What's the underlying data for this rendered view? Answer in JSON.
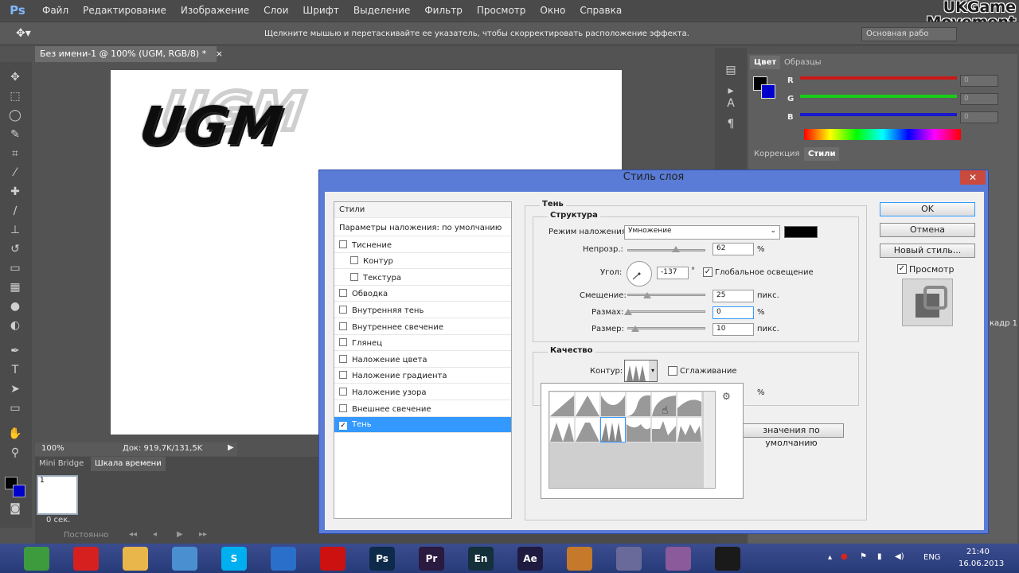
{
  "app": {
    "logo": "Ps",
    "menu": [
      "Файл",
      "Редактирование",
      "Изображение",
      "Слои",
      "Шрифт",
      "Выделение",
      "Фильтр",
      "Просмотр",
      "Окно",
      "Справка"
    ],
    "watermark_line1": "UKGame",
    "watermark_line2": "Movement"
  },
  "options_bar": {
    "hint": "Щелкните мышью и перетаскивайте ее указатель, чтобы скорректировать расположение эффекта.",
    "workspace": "Основная рабо"
  },
  "document": {
    "tab_title": "Без имени-1 @ 100% (UGM, RGB/8) *",
    "canvas_text": "UGM",
    "zoom": "100%",
    "doc_info": "Док: 919,7K/131,5K"
  },
  "timeline": {
    "tab_mini_bridge": "Mini Bridge",
    "tab_timeline": "Шкала времени",
    "frame_number": "1",
    "frame_time": "0 сек.",
    "loop": "Постоянно"
  },
  "color_panel": {
    "tab_color": "Цвет",
    "tab_swatches": "Образцы",
    "r_label": "R",
    "g_label": "G",
    "b_label": "B",
    "r_value": "0",
    "g_value": "0",
    "b_value": "0"
  },
  "styles_panel": {
    "tab_adjustments": "Коррекция",
    "tab_styles": "Стили",
    "frame_label": "кадр 1"
  },
  "dialog": {
    "title": "Стиль слоя",
    "close": "✕",
    "styles_header": "Стили",
    "blend_defaults": "Параметры наложения: по умолчанию",
    "items": [
      {
        "label": "Тиснение",
        "checked": false
      },
      {
        "label": "Контур",
        "checked": false
      },
      {
        "label": "Текстура",
        "checked": false
      },
      {
        "label": "Обводка",
        "checked": false
      },
      {
        "label": "Внутренняя тень",
        "checked": false
      },
      {
        "label": "Внутреннее свечение",
        "checked": false
      },
      {
        "label": "Глянец",
        "checked": false
      },
      {
        "label": "Наложение цвета",
        "checked": false
      },
      {
        "label": "Наложение градиента",
        "checked": false
      },
      {
        "label": "Наложение узора",
        "checked": false
      },
      {
        "label": "Внешнее свечение",
        "checked": false
      },
      {
        "label": "Тень",
        "checked": true
      }
    ],
    "shadow_title": "Тень",
    "structure_title": "Структура",
    "blend_mode_label": "Режим наложения:",
    "blend_mode_value": "Умножение",
    "opacity_label": "Непрозр.:",
    "opacity_value": "62",
    "opacity_level": 0.62,
    "percent": "%",
    "angle_label": "Угол:",
    "angle_value": "-137",
    "degree": "°",
    "global_light_label": "Глобальное освещение",
    "offset_label": "Смещение:",
    "offset_value": "25",
    "spread_label": "Размах:",
    "spread_value": "0",
    "size_label": "Размер:",
    "size_value": "10",
    "px": "пикс.",
    "quality_title": "Качество",
    "contour_label": "Контур:",
    "antialias_label": "Сглаживание",
    "noise_percent": "%",
    "reset_defaults": "значения по умолчанию",
    "ok": "OK",
    "cancel": "Отмена",
    "new_style": "Новый стиль...",
    "preview_label": "Просмотр",
    "check_mark": "✓",
    "gear": "⚙"
  },
  "taskbar": {
    "apps": [
      {
        "name": "chrome",
        "label": "",
        "color": "#3d9b3d"
      },
      {
        "name": "opera",
        "label": "",
        "color": "#d62020"
      },
      {
        "name": "explorer",
        "label": "",
        "color": "#e8b64a"
      },
      {
        "name": "control-panel",
        "label": "",
        "color": "#4a90d0"
      },
      {
        "name": "skype",
        "label": "S",
        "color": "#00aff0"
      },
      {
        "name": "app-swirl",
        "label": "",
        "color": "#2a6fc9"
      },
      {
        "name": "recorder",
        "label": "",
        "color": "#cc1111"
      },
      {
        "name": "photoshop",
        "label": "Ps",
        "color": "#0e2a4a"
      },
      {
        "name": "premiere",
        "label": "Pr",
        "color": "#2b1a3f"
      },
      {
        "name": "encore",
        "label": "En",
        "color": "#14303a"
      },
      {
        "name": "after-effects",
        "label": "Ae",
        "color": "#1f1a3f"
      },
      {
        "name": "paint",
        "label": "",
        "color": "#c47a2a"
      },
      {
        "name": "editor",
        "label": "",
        "color": "#6a6a9a"
      },
      {
        "name": "tool",
        "label": "",
        "color": "#8a5a9a"
      },
      {
        "name": "audio",
        "label": "",
        "color": "#1a1a1a"
      }
    ],
    "lang": "ENG",
    "time": "21:40",
    "date": "16.06.2013"
  }
}
